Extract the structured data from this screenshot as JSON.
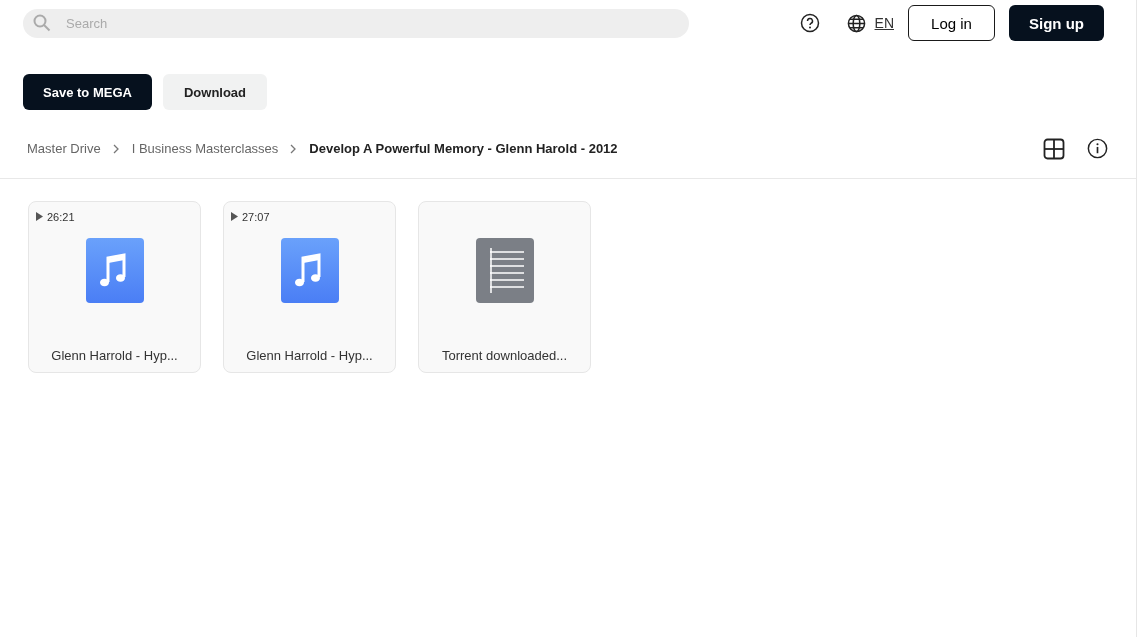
{
  "search": {
    "placeholder": "Search"
  },
  "header": {
    "language": "EN",
    "login": "Log in",
    "signup": "Sign up"
  },
  "actions": [
    "Save to MEGA",
    "Download"
  ],
  "breadcrumb": [
    "Master Drive",
    "I Business Masterclasses",
    "Develop A Powerful Memory - Glenn Harold - 2012"
  ],
  "files": [
    {
      "kind": "audio",
      "duration": "26:21",
      "name": "Glenn Harrold - Hyp..."
    },
    {
      "kind": "audio",
      "duration": "27:07",
      "name": "Glenn Harrold - Hyp..."
    },
    {
      "kind": "document",
      "name": "Torrent downloaded..."
    }
  ]
}
